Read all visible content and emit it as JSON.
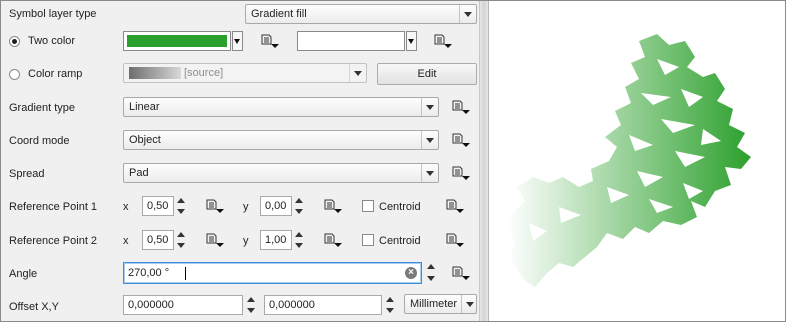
{
  "symbol_layer": {
    "label": "Symbol layer type",
    "value": "Gradient fill"
  },
  "two_color": {
    "label": "Two color",
    "selected": true,
    "color1": "#2ca02c",
    "color2": "#ffffff"
  },
  "color_ramp": {
    "label": "Color ramp",
    "selected": false,
    "value": "[source]",
    "edit_label": "Edit"
  },
  "gradient_type": {
    "label": "Gradient type",
    "value": "Linear"
  },
  "coord_mode": {
    "label": "Coord mode",
    "value": "Object"
  },
  "spread": {
    "label": "Spread",
    "value": "Pad"
  },
  "ref_point_1": {
    "label": "Reference Point 1",
    "x_label": "x",
    "x": "0,50",
    "y_label": "y",
    "y": "0,00",
    "centroid_label": "Centroid",
    "centroid_checked": false
  },
  "ref_point_2": {
    "label": "Reference Point 2",
    "x_label": "x",
    "x": "0,50",
    "y_label": "y",
    "y": "1,00",
    "centroid_label": "Centroid",
    "centroid_checked": false
  },
  "angle": {
    "label": "Angle",
    "value": "270,00 °"
  },
  "offset": {
    "label": "Offset X,Y",
    "x": "0,000000",
    "y": "0,000000",
    "unit": "Millimeter"
  },
  "icons": {
    "data_defined": "data-defined-override-icon",
    "clear": "clear-field-icon",
    "spin": "spinbox-arrows-icon"
  }
}
